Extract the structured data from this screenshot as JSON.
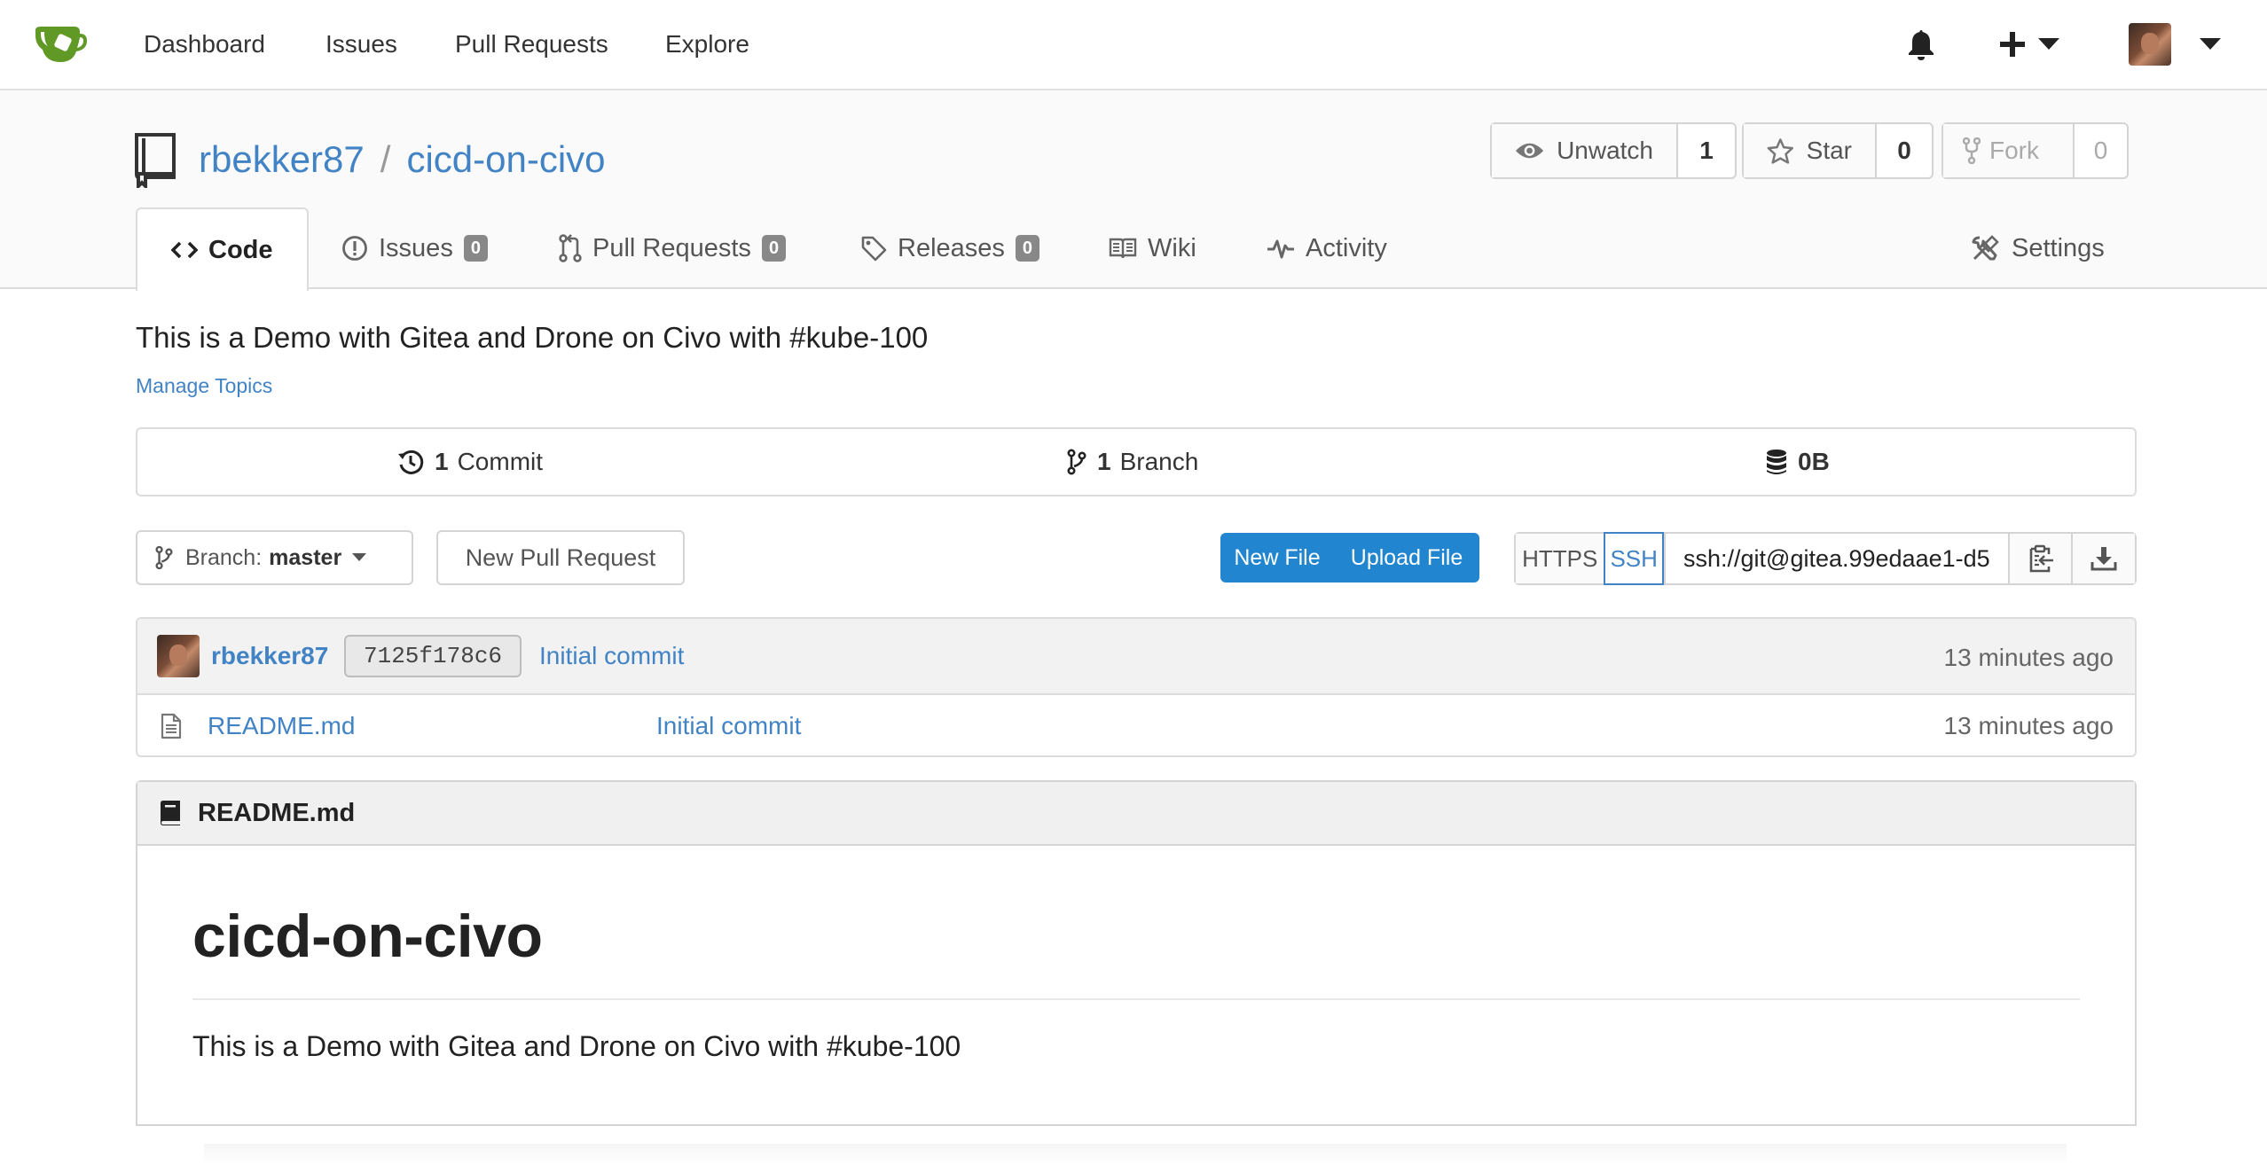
{
  "nav": {
    "items": [
      "Dashboard",
      "Issues",
      "Pull Requests",
      "Explore"
    ],
    "colors": {
      "logo": "#609926"
    }
  },
  "repo": {
    "owner": "rbekker87",
    "separator": "/",
    "name": "cicd-on-civo",
    "watch": {
      "label": "Unwatch",
      "count": "1"
    },
    "star": {
      "label": "Star",
      "count": "0"
    },
    "fork": {
      "label": "Fork",
      "count": "0"
    }
  },
  "tabs": {
    "code": "Code",
    "issues": {
      "label": "Issues",
      "count": "0"
    },
    "pulls": {
      "label": "Pull Requests",
      "count": "0"
    },
    "releases": {
      "label": "Releases",
      "count": "0"
    },
    "wiki": "Wiki",
    "activity": "Activity",
    "settings": "Settings"
  },
  "description": "This is a Demo with Gitea and Drone on Civo with #kube-100",
  "manage_topics": "Manage Topics",
  "stats": {
    "commits": {
      "count": "1",
      "label": "Commit"
    },
    "branches": {
      "count": "1",
      "label": "Branch"
    },
    "size": "0B"
  },
  "toolbar": {
    "branch_label": "Branch:",
    "branch_value": "master",
    "new_pull_request": "New Pull Request",
    "new_file": "New File",
    "upload_file": "Upload File",
    "https": "HTTPS",
    "ssh": "SSH",
    "clone_url": "ssh://git@gitea.99edaae1-d5"
  },
  "latest_commit": {
    "author": "rbekker87",
    "sha": "7125f178c6",
    "message": "Initial commit",
    "time": "13 minutes ago"
  },
  "files": [
    {
      "name": "README.md",
      "commit": "Initial commit",
      "time": "13 minutes ago"
    }
  ],
  "readme": {
    "filename": "README.md",
    "heading": "cicd-on-civo",
    "body": "This is a Demo with Gitea and Drone on Civo with #kube-100"
  }
}
